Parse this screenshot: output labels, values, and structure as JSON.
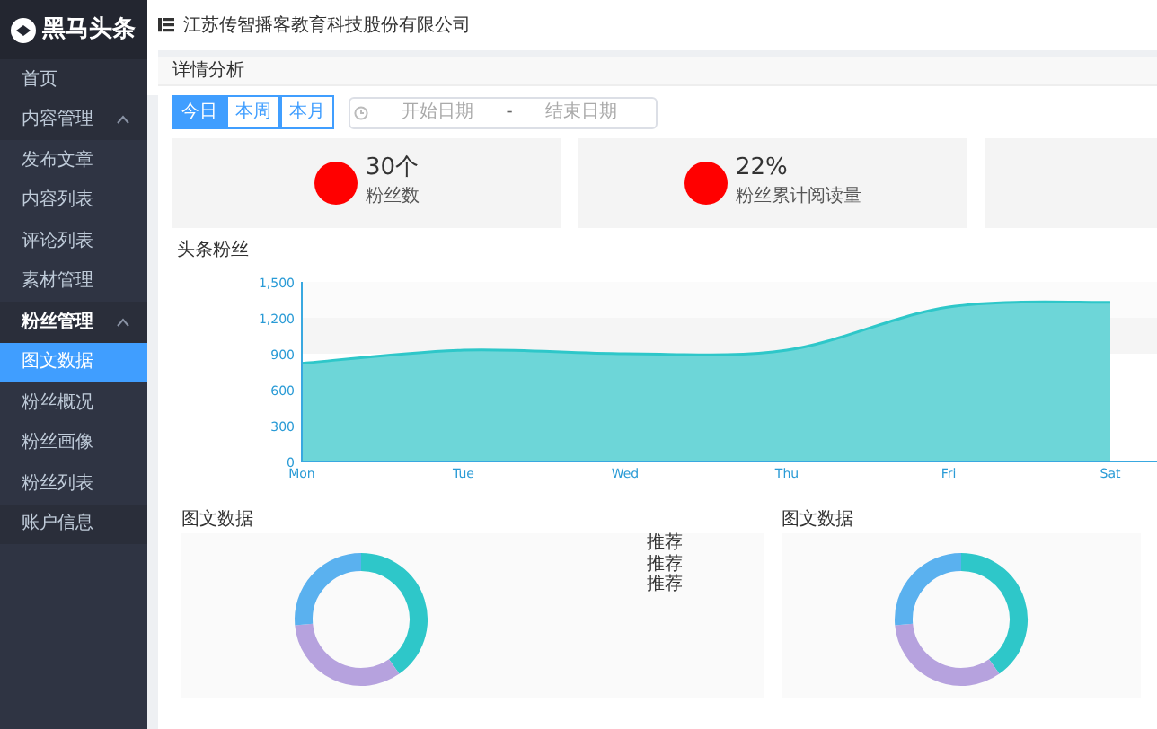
{
  "sidebar": {
    "logo": "黑马头条",
    "items": [
      {
        "label": "首页"
      },
      {
        "label": "内容管理",
        "expanded": true,
        "children": [
          {
            "label": "发布文章",
            "selected": false
          },
          {
            "label": "内容列表",
            "selected": false
          },
          {
            "label": "评论列表",
            "selected": false
          },
          {
            "label": "素材管理",
            "selected": false
          }
        ]
      },
      {
        "label": "粉丝管理",
        "expanded": true,
        "children": [
          {
            "label": "图文数据",
            "selected": true
          },
          {
            "label": "粉丝概况",
            "selected": false
          },
          {
            "label": "粉丝画像",
            "selected": false
          },
          {
            "label": "粉丝列表",
            "selected": false
          }
        ]
      },
      {
        "label": "账户信息"
      }
    ]
  },
  "header": {
    "title": "江苏传智播客教育科技股份有限公司"
  },
  "panel_title": "详情分析",
  "range_buttons": [
    {
      "label": "今日",
      "selected": true
    },
    {
      "label": "本周",
      "selected": false
    },
    {
      "label": "本月",
      "selected": false
    }
  ],
  "date_range": {
    "start_placeholder": "开始日期",
    "separator": "-",
    "end_placeholder": "结束日期"
  },
  "stats": [
    {
      "kind": "value",
      "value": "30个",
      "label": "粉丝数"
    },
    {
      "kind": "value",
      "value": "22%",
      "label": "粉丝累计阅读量"
    },
    {
      "kind": "blank"
    }
  ],
  "fans_chart": {
    "chart_data": {
      "type": "area",
      "title": "头条粉丝",
      "categories": [
        "Mon",
        "Tue",
        "Wed",
        "Thu",
        "Fri",
        "Sat"
      ],
      "series": [
        {
          "color": "#6dd6d8",
          "values": [
            820,
            930,
            900,
            930,
            1290,
            1330
          ]
        }
      ],
      "ylim": [
        0,
        1500
      ],
      "yticks": [
        {
          "value": 0,
          "label": "0"
        },
        {
          "value": 300,
          "label": "300"
        },
        {
          "value": 600,
          "label": "600"
        },
        {
          "value": 900,
          "label": "900"
        },
        {
          "value": 1200,
          "label": "1,200"
        },
        {
          "value": 1500,
          "label": "1,500"
        }
      ]
    }
  },
  "donut_panels": [
    {
      "title": "图文数据",
      "legend": [
        "推荐",
        "推荐",
        "推荐"
      ]
    },
    {
      "title": "图文数据"
    }
  ]
}
